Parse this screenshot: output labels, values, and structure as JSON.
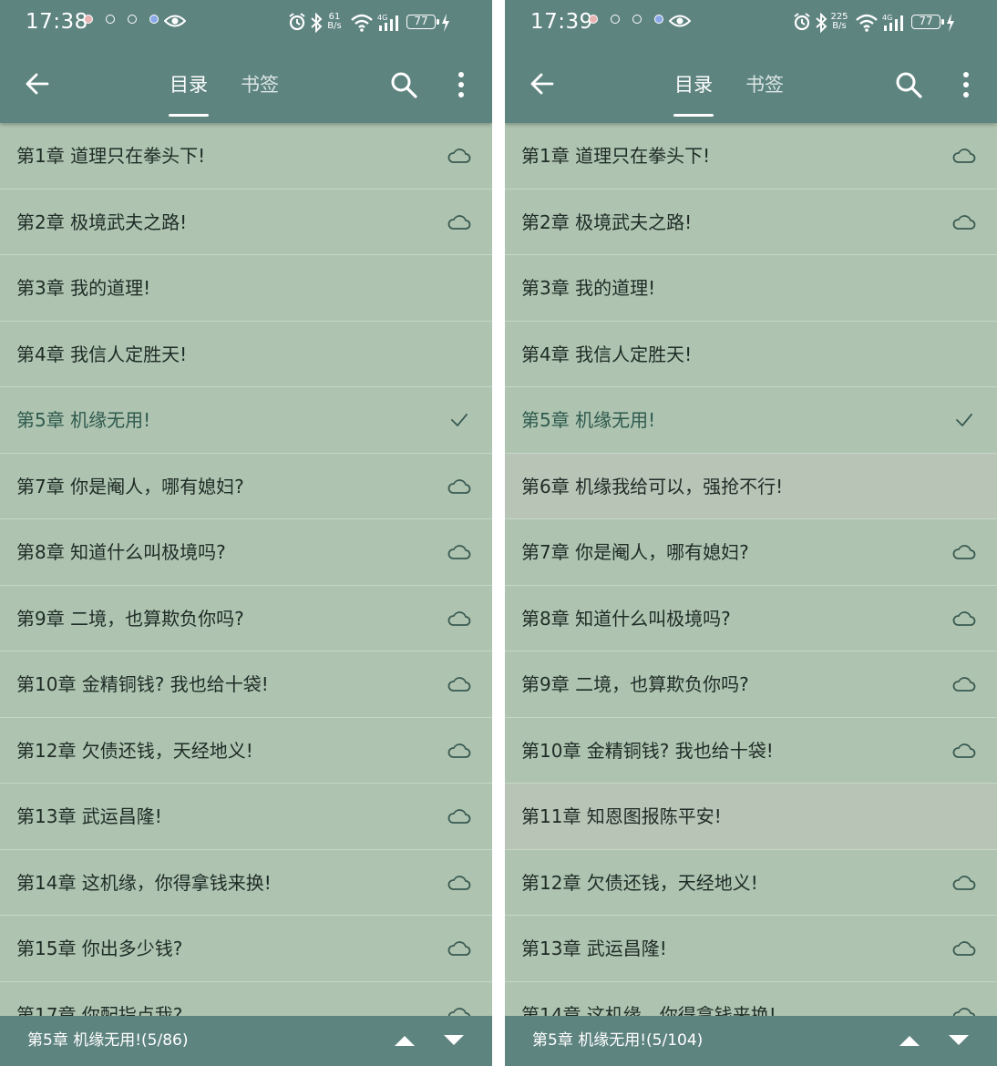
{
  "colors": {
    "accent": "#5e8480",
    "list_bg": "#aec4b0",
    "highlight": "#b8c4b6",
    "text": "#1f2b26",
    "current_text": "#2f5a4f"
  },
  "icons": {
    "back": "arrow-left-icon",
    "search": "search-icon",
    "more": "more-vertical-icon",
    "cloud": "cloud-icon",
    "check": "check-icon",
    "up": "triangle-up-icon",
    "down": "triangle-down-icon"
  },
  "screens": [
    {
      "status": {
        "time": "17:38",
        "net_speed_top": "61",
        "net_speed_bottom": "B/s",
        "battery": "77"
      },
      "tabs": [
        {
          "label": "目录",
          "active": true
        },
        {
          "label": "书签",
          "active": false
        }
      ],
      "chapters": [
        {
          "title": "第1章 道理只在拳头下!",
          "icon": "cloud"
        },
        {
          "title": "第2章 极境武夫之路!",
          "icon": "cloud"
        },
        {
          "title": "第3章 我的道理!",
          "icon": ""
        },
        {
          "title": "第4章 我信人定胜天!",
          "icon": ""
        },
        {
          "title": "第5章 机缘无用!",
          "icon": "check",
          "current": true
        },
        {
          "title": "第7章 你是阉人，哪有媳妇?",
          "icon": "cloud"
        },
        {
          "title": "第8章 知道什么叫极境吗?",
          "icon": "cloud"
        },
        {
          "title": "第9章 二境，也算欺负你吗?",
          "icon": "cloud"
        },
        {
          "title": "第10章 金精铜钱? 我也给十袋!",
          "icon": "cloud"
        },
        {
          "title": "第12章 欠债还钱，天经地义!",
          "icon": "cloud"
        },
        {
          "title": "第13章 武运昌隆!",
          "icon": "cloud"
        },
        {
          "title": "第14章 这机缘，你得拿钱来换!",
          "icon": "cloud"
        },
        {
          "title": "第15章 你出多少钱?",
          "icon": "cloud"
        },
        {
          "title": "第17章 你配指点我?",
          "icon": "cloud"
        }
      ],
      "bottom": {
        "current": "第5章 机缘无用!(5/86)"
      }
    },
    {
      "status": {
        "time": "17:39",
        "net_speed_top": "225",
        "net_speed_bottom": "B/s",
        "battery": "77"
      },
      "tabs": [
        {
          "label": "目录",
          "active": true
        },
        {
          "label": "书签",
          "active": false
        }
      ],
      "chapters": [
        {
          "title": "第1章 道理只在拳头下!",
          "icon": "cloud"
        },
        {
          "title": "第2章 极境武夫之路!",
          "icon": "cloud"
        },
        {
          "title": "第3章 我的道理!",
          "icon": ""
        },
        {
          "title": "第4章 我信人定胜天!",
          "icon": ""
        },
        {
          "title": "第5章 机缘无用!",
          "icon": "check",
          "current": true
        },
        {
          "title": "第6章 机缘我给可以，强抢不行!",
          "icon": "",
          "highlight": true
        },
        {
          "title": "第7章 你是阉人，哪有媳妇?",
          "icon": "cloud"
        },
        {
          "title": "第8章 知道什么叫极境吗?",
          "icon": "cloud"
        },
        {
          "title": "第9章 二境，也算欺负你吗?",
          "icon": "cloud"
        },
        {
          "title": "第10章 金精铜钱? 我也给十袋!",
          "icon": "cloud"
        },
        {
          "title": "第11章 知恩图报陈平安!",
          "icon": "",
          "highlight": true
        },
        {
          "title": "第12章 欠债还钱，天经地义!",
          "icon": "cloud"
        },
        {
          "title": "第13章 武运昌隆!",
          "icon": "cloud"
        },
        {
          "title": "第14章 这机缘，你得拿钱来换!",
          "icon": "cloud"
        }
      ],
      "bottom": {
        "current": "第5章 机缘无用!(5/104)"
      }
    }
  ]
}
